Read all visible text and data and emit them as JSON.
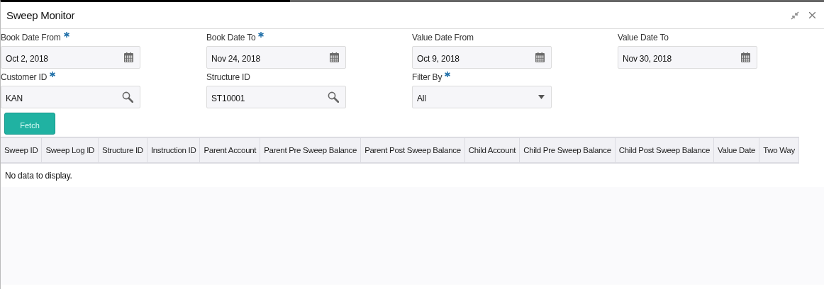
{
  "window": {
    "title": "Sweep Monitor"
  },
  "fields": [
    {
      "label": "Book Date From",
      "required": true,
      "kind": "date",
      "value": "Oct 2, 2018"
    },
    {
      "label": "Book Date To",
      "required": true,
      "kind": "date",
      "value": "Nov 24, 2018"
    },
    {
      "label": "Value Date From",
      "required": false,
      "kind": "date",
      "value": "Oct 9, 2018"
    },
    {
      "label": "Value Date To",
      "required": false,
      "kind": "date",
      "value": "Nov 30, 2018"
    },
    {
      "label": "Customer ID",
      "required": true,
      "kind": "search",
      "value": "KAN"
    },
    {
      "label": "Structure ID",
      "required": false,
      "kind": "search",
      "value": "ST10001"
    },
    {
      "label": "Filter By",
      "required": true,
      "kind": "select",
      "value": "All"
    }
  ],
  "fetch_button": "Fetch",
  "table": {
    "columns": [
      "Sweep ID",
      "Sweep Log ID",
      "Structure ID",
      "Instruction ID",
      "Parent Account",
      "Parent Pre Sweep Balance",
      "Parent Post Sweep Balance",
      "Child Account",
      "Child Pre Sweep Balance",
      "Child Post Sweep Balance",
      "Value Date",
      "Two Way"
    ],
    "empty_message": "No data to display."
  }
}
